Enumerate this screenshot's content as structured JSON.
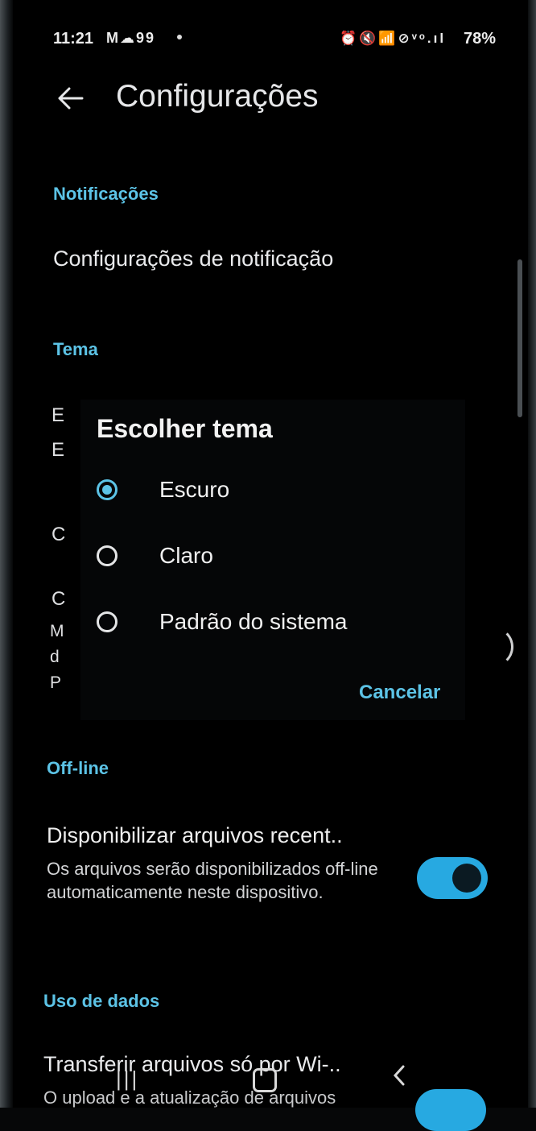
{
  "status_bar": {
    "time": "11:21",
    "left_icons": "M☁99",
    "right_icons": "⏰🔇📶⊘ᵛᵒ.ıl",
    "battery": "78%"
  },
  "app_bar": {
    "title": "Configurações",
    "back_icon": "arrow-left-icon"
  },
  "sections": {
    "notifications": {
      "header": "Notificações",
      "item": "Configurações de notificação"
    },
    "theme": {
      "header": "Tema",
      "partial_letters": [
        "E",
        "E"
      ]
    },
    "other": {
      "partial_letters": [
        "C",
        "C",
        "M",
        "d",
        "P"
      ]
    },
    "offline": {
      "header": "Off-line",
      "title": "Disponibilizar arquivos recent..",
      "description": "Os arquivos serão disponibilizados off-line automaticamente neste dispositivo.",
      "toggle_on": true
    },
    "data_usage": {
      "header": "Uso de dados",
      "title": "Transferir arquivos só por Wi-..",
      "description": "O upload e a atualização de arquivos"
    }
  },
  "dialog": {
    "title": "Escolher tema",
    "options": [
      {
        "label": "Escuro",
        "selected": true
      },
      {
        "label": "Claro",
        "selected": false
      },
      {
        "label": "Padrão do sistema",
        "selected": false
      }
    ],
    "cancel_label": "Cancelar"
  },
  "nav_bar": {
    "recent": "|||"
  },
  "colors": {
    "accent": "#5cc3e6",
    "toggle": "#27a9e1",
    "background": "#000000"
  }
}
